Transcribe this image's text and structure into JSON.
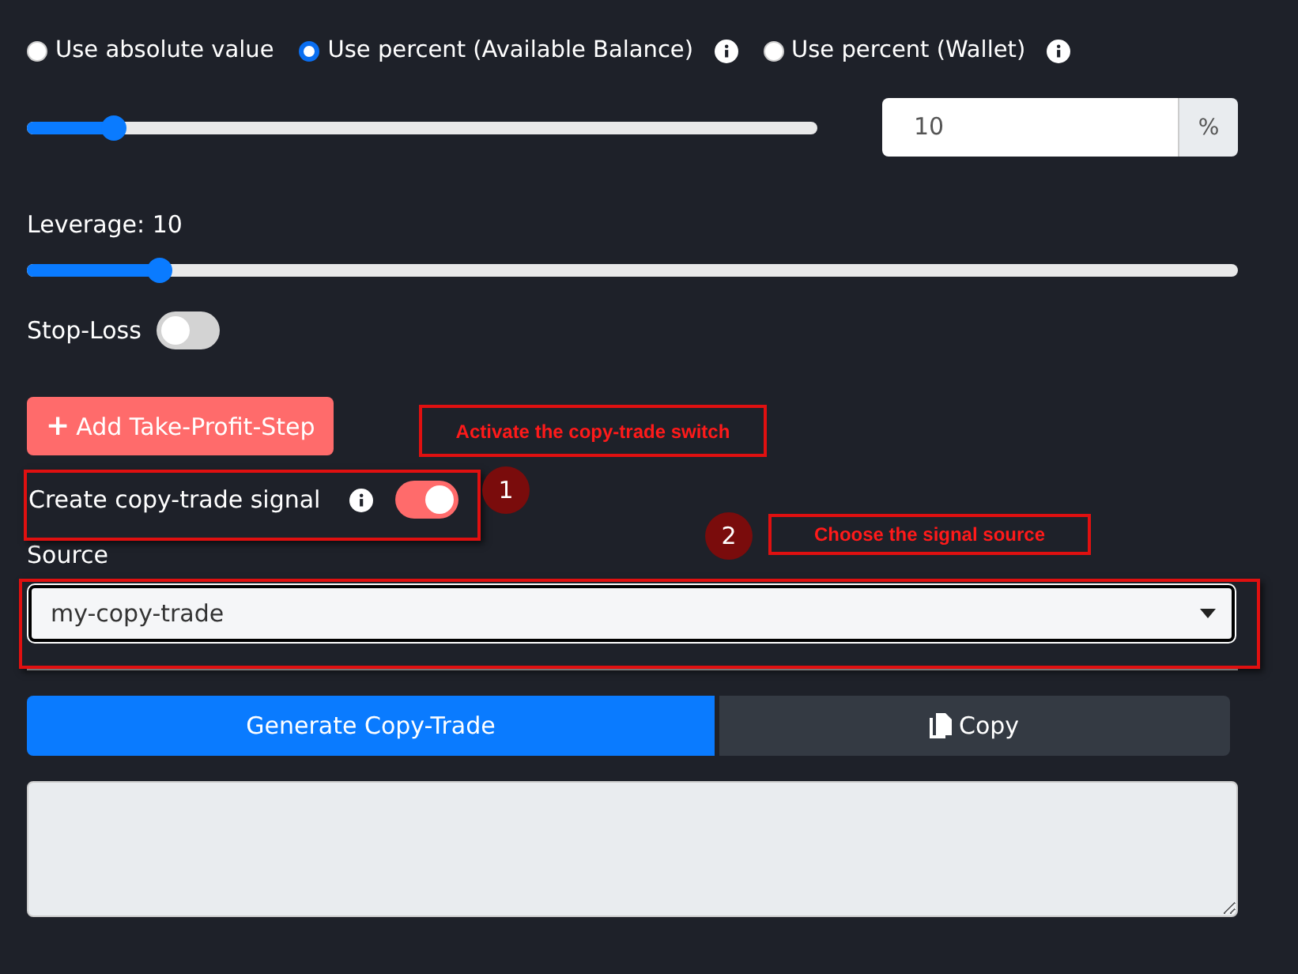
{
  "allocation_modes": [
    {
      "label": "Use absolute value",
      "selected": false,
      "info": false
    },
    {
      "label": "Use percent (Available Balance)",
      "selected": true,
      "info": true
    },
    {
      "label": "Use percent (Wallet)",
      "selected": false,
      "info": true
    }
  ],
  "amount": {
    "level": 0.11,
    "value": "10",
    "unit": "%"
  },
  "leverage": {
    "label": "Leverage: 10",
    "level": 0.11
  },
  "stop_loss": {
    "label": "Stop-Loss",
    "on": false
  },
  "add_take_profit_button": {
    "icon": "+",
    "label": "Add Take-Profit-Step"
  },
  "copy_trade_signal": {
    "label": "Create copy-trade signal",
    "on": true
  },
  "source": {
    "label": "Source",
    "value": "my-copy-trade"
  },
  "generate_button": "Generate Copy-Trade",
  "copy_button": "Copy",
  "annotations": [
    {
      "number": "1",
      "text": "Activate the copy-trade switch"
    },
    {
      "number": "2",
      "text": "Choose the signal source"
    }
  ]
}
